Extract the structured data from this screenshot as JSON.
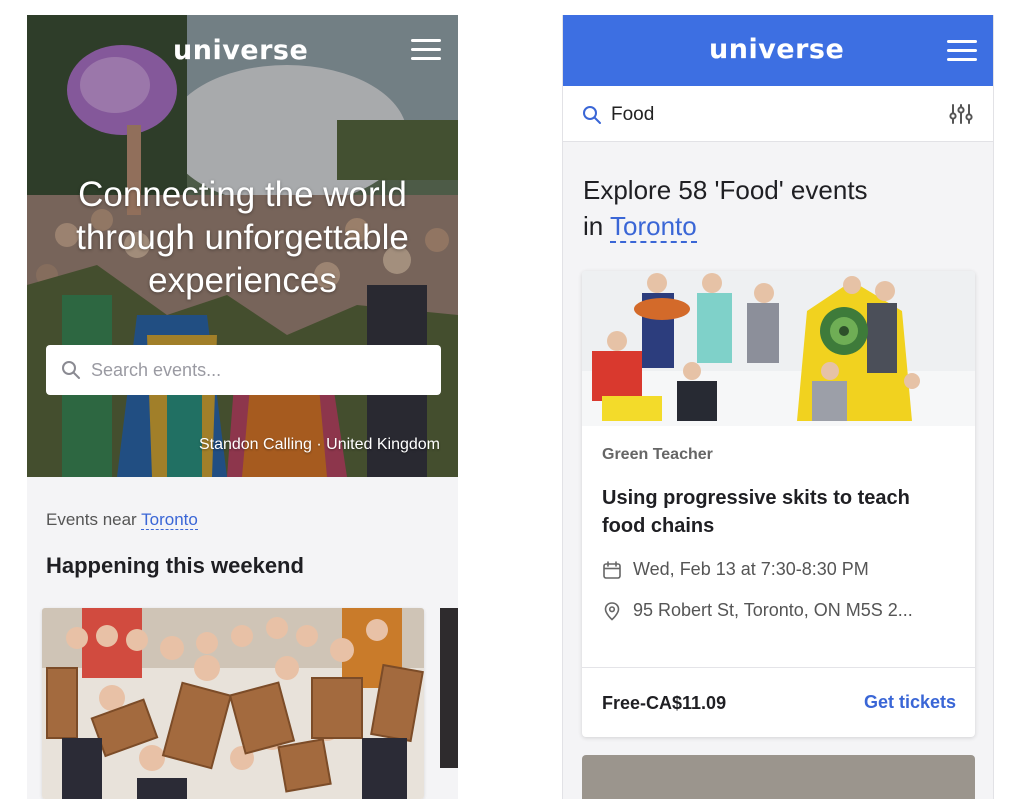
{
  "left_screen": {
    "brand": "universe",
    "hero": {
      "title": "Connecting the world through unforgettable experiences",
      "search_placeholder": "Search events...",
      "photo_credit": "Standon Calling · United Kingdom"
    },
    "events_near_prefix": "Events near",
    "events_near_city": "Toronto",
    "section_title": "Happening this weekend"
  },
  "right_screen": {
    "brand": "universe",
    "search_query": "Food",
    "explore_prefix": "Explore 58 'Food' events",
    "explore_in": "in",
    "explore_city": "Toronto",
    "event": {
      "organizer": "Green Teacher",
      "title": "Using progressive skits to teach food chains",
      "date": "Wed, Feb 13 at 7:30-8:30 PM",
      "location": "95 Robert St, Toronto, ON M5S 2...",
      "price": "Free-CA$11.09",
      "cta": "Get tickets"
    }
  },
  "colors": {
    "brand_blue": "#3d6fe2",
    "link_blue": "#3a66d6",
    "page_bg": "#f4f4f6"
  },
  "icons": [
    "menu-icon",
    "search-icon",
    "filter-icon",
    "calendar-icon",
    "location-pin-icon"
  ]
}
